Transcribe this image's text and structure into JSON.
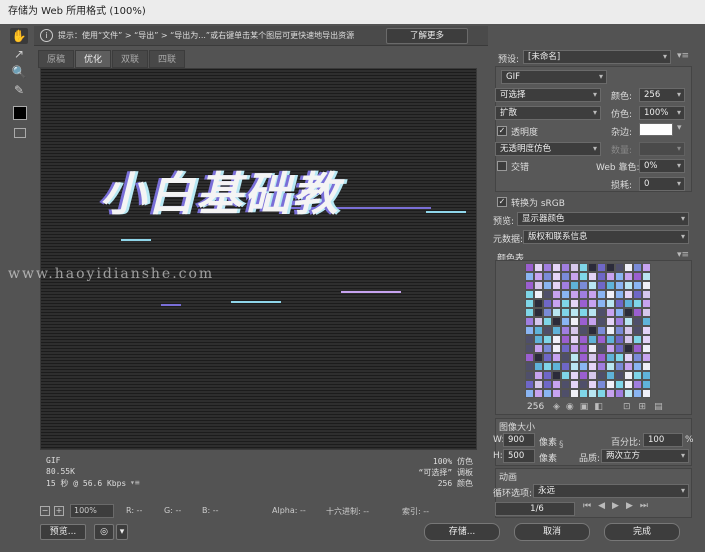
{
  "window": {
    "title": "存储为 Web 所用格式 (100%)"
  },
  "tip": {
    "text": "提示：使用“文件” > “导出” > “导出为...”或右键单击某个图层可更快速地导出资源",
    "learn_more": "了解更多"
  },
  "tabs": [
    {
      "label": "原稿",
      "active": false
    },
    {
      "label": "优化",
      "active": true
    },
    {
      "label": "双联",
      "active": false
    },
    {
      "label": "四联",
      "active": false
    }
  ],
  "preview": {
    "image_text": "小白基础教",
    "status": {
      "format": "GIF",
      "size": "80.55K",
      "time": "15 秒 @ 56.6 Kbps",
      "dither": "100% 仿色",
      "palette": "“可选择” 调板",
      "colors": "256 颜色"
    }
  },
  "bottom": {
    "zoom": "100%",
    "r": "R: --",
    "g": "G: --",
    "b": "B: --",
    "alpha": "Alpha: --",
    "hex": "十六进制: --",
    "index": "索引: --",
    "preview_btn": "预览...",
    "save_btn": "存储...",
    "cancel_btn": "取消",
    "done_btn": "完成"
  },
  "settings": {
    "preset_label": "预设:",
    "preset_value": "[未命名]",
    "format": "GIF",
    "reduction": "可选择",
    "colors_label": "颜色:",
    "colors_value": "256",
    "dither_algo": "扩散",
    "dither_label": "仿色:",
    "dither_value": "100%",
    "transparency_label": "透明度",
    "transparency_checked": true,
    "matte_label": "杂边:",
    "trans_dither": "无透明度仿色",
    "amount_label": "数量:",
    "interlaced_label": "交错",
    "web_snap_label": "Web 靠色:",
    "web_snap_value": "0%",
    "lossy_label": "损耗:",
    "lossy_value": "0",
    "srgb_label": "转换为 sRGB",
    "srgb_checked": true,
    "preview_label": "预览:",
    "preview_value": "显示器颜色",
    "metadata_label": "元数据:",
    "metadata_value": "版权和联系信息"
  },
  "color_table": {
    "title": "颜色表",
    "count": "256"
  },
  "image_size": {
    "title": "图像大小",
    "w_label": "W:",
    "w_value": "900",
    "h_label": "H:",
    "h_value": "500",
    "unit": "像素",
    "percent_label": "百分比:",
    "percent_value": "100",
    "percent_unit": "%",
    "quality_label": "品质:",
    "quality_value": "两次立方"
  },
  "animation": {
    "title": "动画",
    "loop_label": "循环选项:",
    "loop_value": "永远",
    "frame": "1/6"
  },
  "watermark": "www.haoyidianshe.com",
  "colors": {
    "palette": [
      "#7fd6e8",
      "#c7a3f0",
      "#a07ee0",
      "#5fb3d9",
      "#8ab5f2",
      "#e4d4f7",
      "#6f67c8",
      "#2b2b3a",
      "#4f4f6a",
      "#b9e6f2",
      "#9b5fd0",
      "#d6c7ec",
      "#7a8bd8",
      "#f0f0f8"
    ]
  }
}
